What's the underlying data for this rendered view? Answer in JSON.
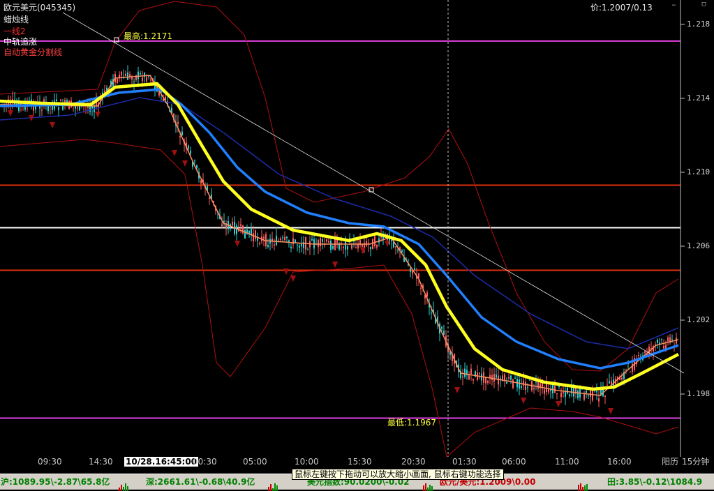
{
  "window": {
    "symbol_title": "欧元美元(045345)",
    "indicator_name": "蜡烛线",
    "overlays": [
      {
        "label": "一线2",
        "color": "#ff3030"
      },
      {
        "label": "中轨追涨",
        "color": "#ffffff"
      },
      {
        "label": "自动黄金分割线",
        "color": "#ff4040"
      }
    ],
    "price_readout": "价:1.2007/0.13"
  },
  "chart_data": {
    "type": "candlestick",
    "y_axis_ticks": [
      "1.218",
      "1.214",
      "1.210",
      "1.206",
      "1.202",
      "1.198"
    ],
    "ylim": [
      1.1955,
      1.2195
    ],
    "annotations": {
      "high_label": "最高:1.2171",
      "low_label": "最低:1.1967"
    },
    "horizontal_levels": [
      {
        "price": 1.2171,
        "color": "#e040e0"
      },
      {
        "price": 1.2093,
        "color": "#e03010"
      },
      {
        "price": 1.207,
        "color": "#ffffff"
      },
      {
        "price": 1.2047,
        "color": "#e03010"
      },
      {
        "price": 1.1967,
        "color": "#e040e0"
      }
    ],
    "x_ticks": [
      "09:30",
      "14:30",
      "00:30",
      "05:00",
      "10:00",
      "15:30",
      "20:30",
      "01:30",
      "06:00",
      "11:00",
      "16:00"
    ],
    "current_time_label": "10/28.16:45:00",
    "axis_corner_label": "阳历",
    "period_label": "15分钟"
  },
  "statusbar": {
    "items": [
      {
        "text": "沪:1089.95\\-2.87\\65.8亿",
        "color": "#008000"
      },
      {
        "text": "深:2661.61\\-0.68\\40.9亿",
        "color": "#008000"
      },
      {
        "text": "美元指数:90.0200\\-0.02",
        "color": "#008000"
      },
      {
        "text": "欧元/美元:1.2009\\0.00",
        "color": "#c00000"
      },
      {
        "text": "田:3.85\\-0.12\\1084.9",
        "color": "#008000"
      }
    ],
    "tooltip": "鼠标左键按下拖动可以放大缩小画面, 鼠标右键功能选择"
  },
  "colors": {
    "background": "#000000",
    "ma_yellow": "#ffff20",
    "ma_blue": "#2080ff",
    "ma_navy": "#1c2ca8",
    "ma_salmon": "#ff9060",
    "bollinger": "#b01010",
    "candle": "#30d0d0",
    "arrow": "#a01010"
  }
}
